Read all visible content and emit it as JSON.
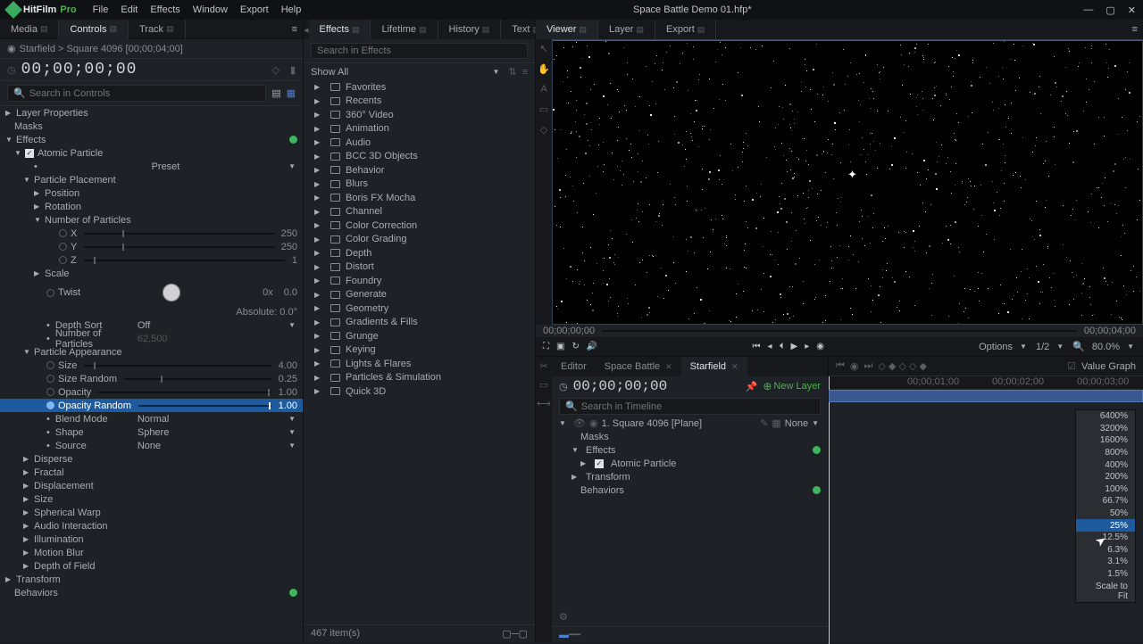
{
  "titlebar": {
    "app_name": "HitFilm",
    "app_suffix": "Pro",
    "menus": [
      "File",
      "Edit",
      "Effects",
      "Window",
      "Export",
      "Help"
    ],
    "project_title": "Space Battle Demo 01.hfp*"
  },
  "left_tabs": {
    "media": "Media",
    "controls": "Controls",
    "track": "Track"
  },
  "controls": {
    "breadcrumb": "Starfield > Square 4096 [00;00;04;00]",
    "timecode": "00;00;00;00",
    "search_placeholder": "Search in Controls",
    "layer_properties": "Layer Properties",
    "masks": "Masks",
    "effects": "Effects",
    "particle": {
      "name": "Atomic Particle",
      "preset": "Preset",
      "placement": "Particle Placement",
      "position": "Position",
      "rotation": "Rotation",
      "num_particles": "Number of Particles",
      "x": "X",
      "y": "Y",
      "z": "Z",
      "x_val": "250",
      "y_val": "250",
      "z_val": "1",
      "scale": "Scale",
      "twist": "Twist",
      "twist_val_a": "0x",
      "twist_val_b": "0.0",
      "absolute": "Absolute: 0.0°",
      "depth_sort": "Depth Sort",
      "depth_sort_val": "Off",
      "num_particles2": "Number of Particles",
      "num_particles2_val": "62,500",
      "appearance": "Particle Appearance",
      "size": "Size",
      "size_val": "4.00",
      "size_random": "Size Random",
      "size_random_val": "0.25",
      "opacity": "Opacity",
      "opacity_val": "1.00",
      "opacity_random": "Opacity Random",
      "opacity_random_val": "1.00",
      "blend": "Blend Mode",
      "blend_val": "Normal",
      "shape": "Shape",
      "shape_val": "Sphere",
      "source": "Source",
      "source_val": "None",
      "disperse": "Disperse",
      "fractal": "Fractal",
      "displacement": "Displacement",
      "size2": "Size",
      "spherical_warp": "Spherical Warp",
      "audio_interaction": "Audio Interaction",
      "illumination": "Illumination",
      "motion_blur": "Motion Blur",
      "depth_of_field": "Depth of Field"
    },
    "transform": "Transform",
    "behaviors": "Behaviors"
  },
  "effects_panel": {
    "tabs": {
      "effects": "Effects",
      "lifetime": "Lifetime",
      "history": "History",
      "text": "Text"
    },
    "search_placeholder": "Search in Effects",
    "show_all": "Show All",
    "items": [
      "Favorites",
      "Recents",
      "360° Video",
      "Animation",
      "Audio",
      "BCC 3D Objects",
      "Behavior",
      "Blurs",
      "Boris FX Mocha",
      "Channel",
      "Color Correction",
      "Color Grading",
      "Depth",
      "Distort",
      "Foundry",
      "Generate",
      "Geometry",
      "Gradients & Fills",
      "Grunge",
      "Keying",
      "Lights & Flares",
      "Particles & Simulation",
      "Quick 3D"
    ],
    "count": "467 item(s)"
  },
  "viewer": {
    "tabs": {
      "viewer": "Viewer",
      "layer": "Layer",
      "export": "Export"
    },
    "start": "00;00;00;00",
    "end": "00;00;04;00",
    "options": "Options",
    "res": "1/2",
    "zoom": "80.0%"
  },
  "timeline": {
    "tabs": {
      "editor": "Editor",
      "space": "Space Battle",
      "starfield": "Starfield"
    },
    "timecode": "00;00;00;00",
    "new_layer": "New Layer",
    "search_placeholder": "Search in Timeline",
    "value_graph": "Value Graph",
    "layer_name": "1. Square 4096 [Plane]",
    "none": "None",
    "masks": "Masks",
    "effects": "Effects",
    "atomic": "Atomic Particle",
    "transform": "Transform",
    "behaviors": "Behaviors",
    "ruler": [
      "00;00;01;00",
      "00;00;02;00",
      "00;00;03;00"
    ]
  },
  "zoom_menu": [
    "6400%",
    "3200%",
    "1600%",
    "800%",
    "400%",
    "200%",
    "100%",
    "66.7%",
    "50%",
    "25%",
    "12.5%",
    "6.3%",
    "3.1%",
    "1.5%",
    "Scale to Fit"
  ]
}
